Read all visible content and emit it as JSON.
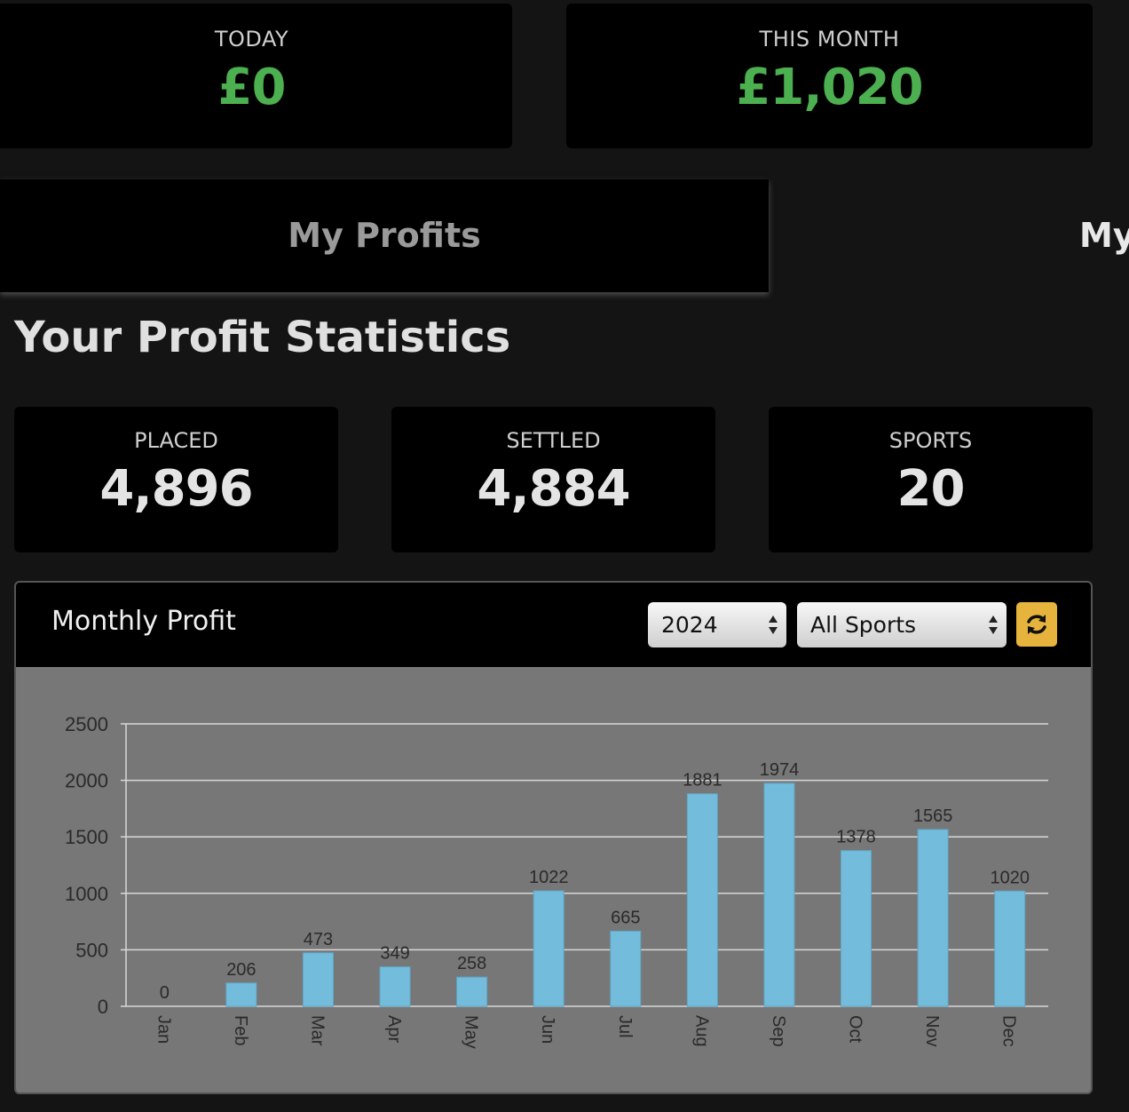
{
  "summary": {
    "today": {
      "label": "TODAY",
      "value": "£0"
    },
    "this_month": {
      "label": "THIS MONTH",
      "value": "£1,020"
    }
  },
  "tabs": {
    "active": "My Profits",
    "inactive": "My"
  },
  "section_title": "Your Profit Statistics",
  "stats": {
    "placed": {
      "label": "PLACED",
      "value": "4,896"
    },
    "settled": {
      "label": "SETTLED",
      "value": "4,884"
    },
    "sports": {
      "label": "SPORTS",
      "value": "20"
    }
  },
  "panel": {
    "title": "Monthly Profit",
    "year_select": "2024",
    "sport_select": "All Sports",
    "refresh_icon": "refresh-icon"
  },
  "colors": {
    "positive": "#4caf50",
    "bar": "#74bcdc",
    "accent_button": "#e6b43c"
  },
  "chart_data": {
    "type": "bar",
    "categories": [
      "Jan",
      "Feb",
      "Mar",
      "Apr",
      "May",
      "Jun",
      "Jul",
      "Aug",
      "Sep",
      "Oct",
      "Nov",
      "Dec"
    ],
    "values": [
      0,
      206,
      473,
      349,
      258,
      1022,
      665,
      1881,
      1974,
      1378,
      1565,
      1020
    ],
    "ylim": [
      0,
      2500
    ],
    "yticks": [
      0,
      500,
      1000,
      1500,
      2000,
      2500
    ],
    "grid": true,
    "data_labels": true
  }
}
